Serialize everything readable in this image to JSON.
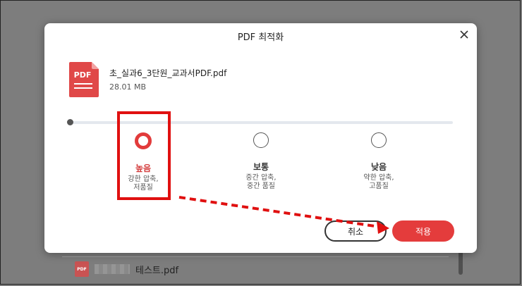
{
  "dialog": {
    "title": "PDF 최적화",
    "file": {
      "icon_text": "PDF",
      "name": "초_실과6_3단원_교과서PDF.pdf",
      "size": "28.01 MB"
    },
    "options": [
      {
        "label": "높음",
        "desc_line1": "강한 압축,",
        "desc_line2": "저품질",
        "selected": true
      },
      {
        "label": "보통",
        "desc_line1": "중간 압축,",
        "desc_line2": "중간 품질",
        "selected": false
      },
      {
        "label": "낮음",
        "desc_line1": "약한 압축,",
        "desc_line2": "고품질",
        "selected": false
      }
    ],
    "cancel_label": "취소",
    "apply_label": "적용"
  },
  "background_list": {
    "icon_text": "PDF",
    "file_name": "테스트.pdf"
  },
  "colors": {
    "accent": "#e43c3c",
    "annotation": "#e01010"
  }
}
